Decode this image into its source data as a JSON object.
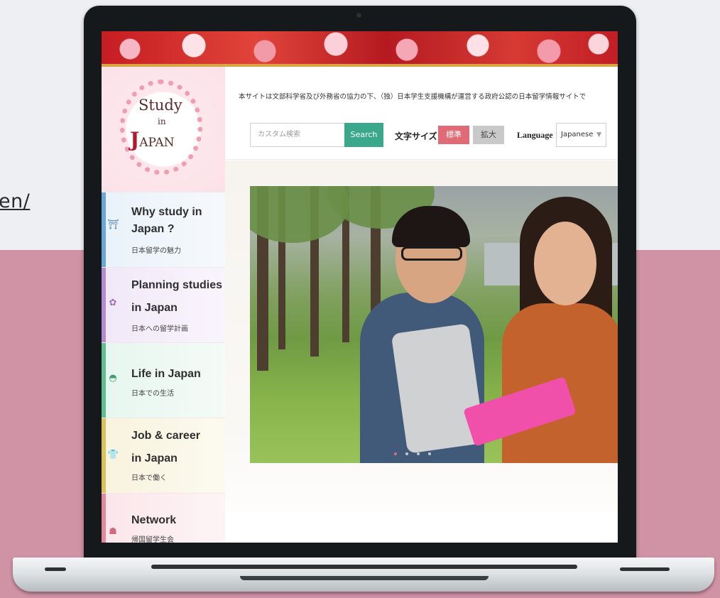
{
  "slide": {
    "url_fragment": "en/"
  },
  "site": {
    "logo": {
      "study": "Study",
      "in": "in",
      "j": "J",
      "apan": "APAN"
    },
    "notice": "本サイトは文部科学省及び外務省の協力の下、（独）日本学生支援機構が運営する政府公認の日本留学情報サイトで",
    "search": {
      "placeholder": "カスタム検索",
      "button": "Search"
    },
    "font_size": {
      "label": "文字サイズ",
      "standard": "標準",
      "large": "拡大"
    },
    "language": {
      "label": "Language",
      "selected": "Japanese"
    },
    "nav": [
      {
        "title_line1": "Why study in",
        "title_line2": "Japan ?",
        "subtitle": "日本留学の魅力",
        "icon": "shrine-gate-icon",
        "color": "#6aa6d9"
      },
      {
        "title_line1": "Planning studies",
        "title_line2": "in Japan",
        "subtitle": "日本への留学計画",
        "icon": "plum-blossom-icon",
        "color": "#b48ad1"
      },
      {
        "title_line1": "Life in Japan",
        "title_line2": "",
        "subtitle": "日本での生活",
        "icon": "rice-bowl-icon",
        "color": "#5fbf8e"
      },
      {
        "title_line1": "Job & career",
        "title_line2": "in Japan",
        "subtitle": "日本で働く",
        "icon": "shirt-icon",
        "color": "#d9c35a"
      },
      {
        "title_line1": "Network",
        "title_line2": "",
        "subtitle": "帰国留学生会",
        "icon": "people-icon",
        "color": "#e08a9c"
      }
    ],
    "carousel": {
      "slide_count": 4,
      "active_index": 0
    }
  }
}
